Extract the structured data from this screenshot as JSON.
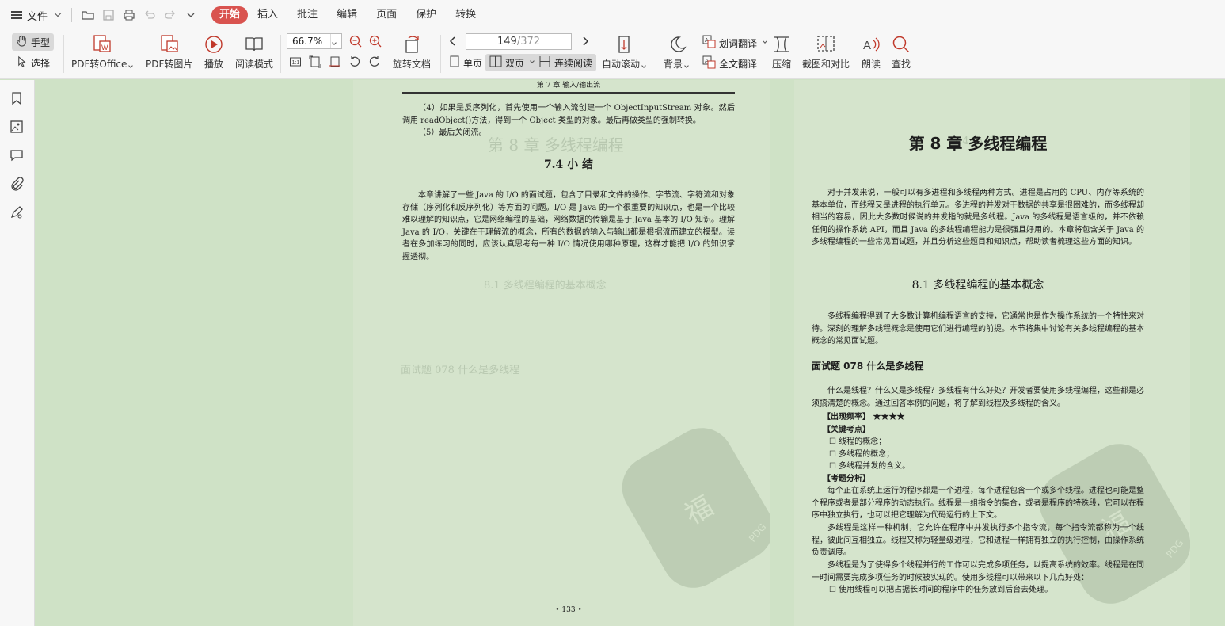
{
  "menubar": {
    "file_label": "文件",
    "tabs": [
      "开始",
      "插入",
      "批注",
      "编辑",
      "页面",
      "保护",
      "转换"
    ]
  },
  "toolbar": {
    "hand": "手型",
    "select": "选择",
    "pdf_to_office": "PDF转Office",
    "pdf_to_image": "PDF转图片",
    "play": "播放",
    "read_mode": "阅读模式",
    "zoom": "66.7%",
    "rotate_doc": "旋转文档",
    "page_current": "149",
    "page_total": "/372",
    "single_page": "单页",
    "double_page": "双页",
    "continuous": "连续阅读",
    "auto_scroll": "自动滚动",
    "background": "背景",
    "word_translate": "划词翻译",
    "full_translate": "全文翻译",
    "compress": "压缩",
    "screenshot_compare": "截图和对比",
    "read_aloud": "朗读",
    "find": "查找"
  },
  "left_page": {
    "header": "第 7 章   输入/输出流",
    "p1": "（4）如果是反序列化，首先使用一个输入流创建一个 ObjectInputStream 对象。然后调用 readObject()方法，得到一个 Object 类型的对象。最后再做类型的强制转换。",
    "p2": "（5）最后关闭流。",
    "section_title": "7.4   小     结",
    "summary": "本章讲解了一些 Java 的 I/O 的面试题，包含了目录和文件的操作、字节流、字符流和对象存储（序列化和反序列化）等方面的问题。I/O 是 Java 的一个很重要的知识点，也是一个比较难以理解的知识点，它是网络编程的基础，网络数据的传输是基于 Java 基本的 I/O 知识。理解 Java 的 I/O，关键在于理解流的概念，所有的数据的输入与输出都是根据流而建立的模型。读者在多加练习的同时，应该认真思考每一种 I/O 情况使用哪种原理，这样才能把 I/O 的知识掌握透彻。",
    "page_number": "• 133 •"
  },
  "right_page": {
    "chapter_title": "第 8 章   多线程编程",
    "intro": "对于并发来说，一般可以有多进程和多线程两种方式。进程是占用的 CPU、内存等系统的基本单位，而线程又是进程的执行单元。多进程的并发对于数据的共享是很困难的，而多线程却相当的容易，因此大多数时候说的并发指的就是多线程。Java 的多线程是语言级的，并不依赖任何的操作系统 API，而且 Java 的多线程编程能力是很强且好用的。本章将包含关于 Java 的多线程编程的一些常见面试题，并且分析这些题目和知识点，帮助读者梳理这些方面的知识。",
    "section_title": "8.1   多线程编程的基本概念",
    "section_intro": "多线程编程得到了大多数计算机编程语言的支持，它通常也是作为操作系统的一个特性来对待。深刻的理解多线程概念是使用它们进行编程的前提。本节将集中讨论有关多线程编程的基本概念的常见面试题。",
    "question_title": "面试题 078   什么是多线程",
    "question_intro": "什么是线程？什么又是多线程？多线程有什么好处？开发者要使用多线程编程，这些都是必须搞清楚的概念。通过回答本例的问题，将了解到线程及多线程的含义。",
    "freq_label": "【出现频率】 ★★★★",
    "key_label": "【关键考点】",
    "key_points": [
      "线程的概念；",
      "多线程的概念；",
      "多线程并发的含义。"
    ],
    "analysis_label": "【考题分析】",
    "a1": "每个正在系统上运行的程序都是一个进程，每个进程包含一个或多个线程。进程也可能是整个程序或者是部分程序的动态执行。线程是一组指令的集合，或者是程序的特殊段，它可以在程序中独立执行，也可以把它理解为代码运行的上下文。",
    "a2": "多线程是这样一种机制，它允许在程序中并发执行多个指令流，每个指令流都称为一个线程，彼此间互相独立。线程又称为轻量级进程，它和进程一样拥有独立的执行控制，由操作系统负责调度。",
    "a3": "多线程是为了使得多个线程并行的工作可以完成多项任务，以提高系统的效率。线程是在同一时间需要完成多项任务的时候被实现的。使用多线程可以带来以下几点好处：",
    "b1": "使用线程可以把占据长时间的程序中的任务放到后台去处理。"
  },
  "colors": {
    "accent": "#d9534f",
    "page_bg": "#d5e4cc",
    "app_bg": "#cfe2c6"
  }
}
